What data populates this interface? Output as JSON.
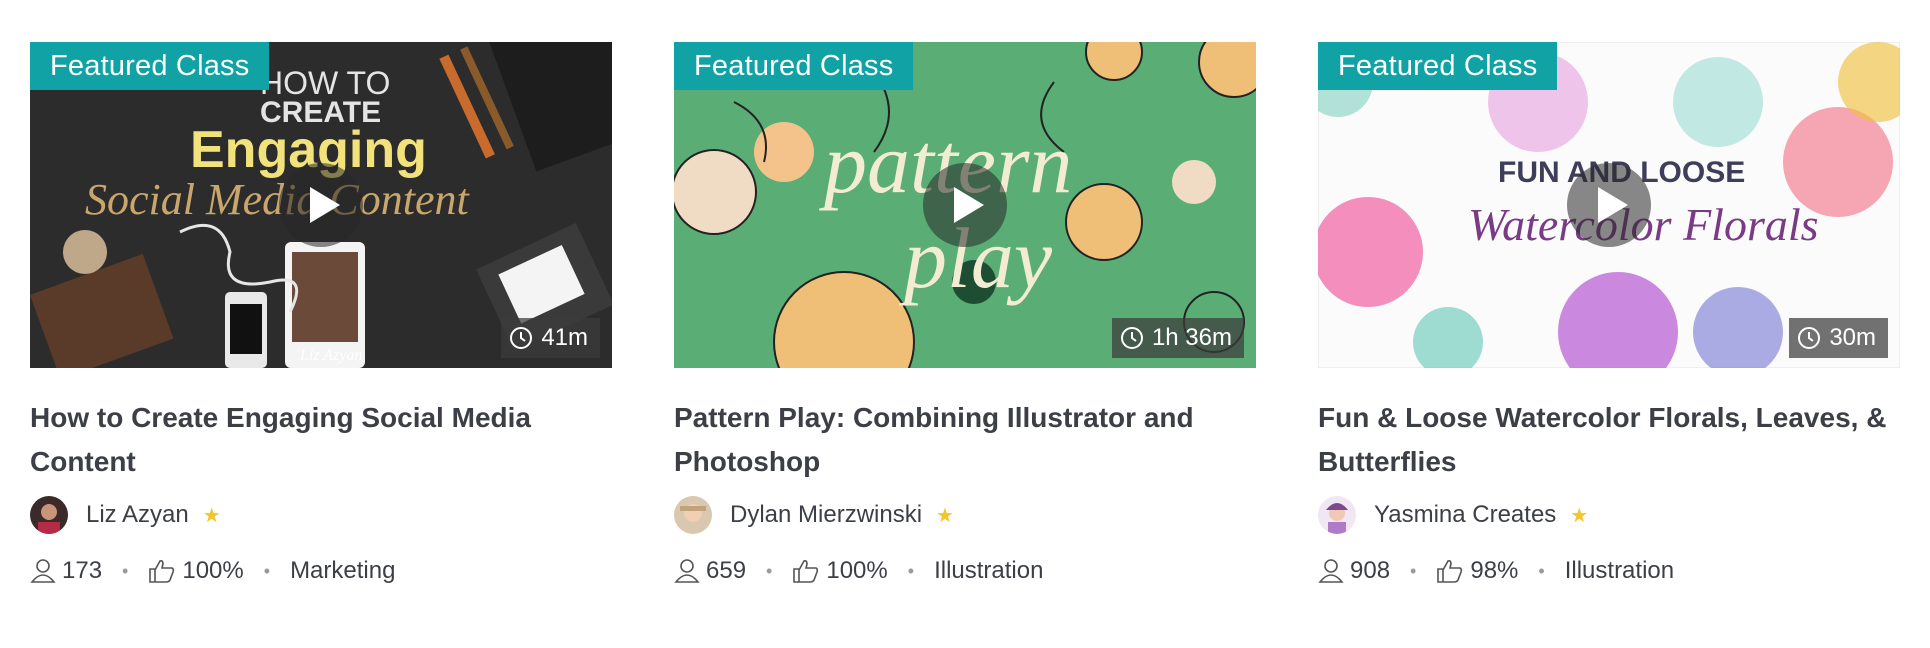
{
  "cards": [
    {
      "badge": "Featured Class",
      "duration": "41m",
      "title_line1": "How to Create Engaging Social Media",
      "title_line2": "Content",
      "teacher": "Liz Azyan",
      "students": "173",
      "rating": "100%",
      "category": "Marketing",
      "art_text": {
        "line1": "HOW TO",
        "line2": "CREATE",
        "line3": "Engaging",
        "line4": "Social Media Content",
        "caption": "Liz Azyan"
      }
    },
    {
      "badge": "Featured Class",
      "duration": "1h 36m",
      "title_line1": "Pattern Play: Combining Illustrator and",
      "title_line2": "Photoshop",
      "teacher": "Dylan Mierzwinski",
      "students": "659",
      "rating": "100%",
      "category": "Illustration",
      "art_text": {
        "line1": "pattern",
        "line2": "play"
      }
    },
    {
      "badge": "Featured Class",
      "duration": "30m",
      "title_line1": "Fun & Loose Watercolor Florals, Leaves, &",
      "title_line2": "Butterflies",
      "teacher": "Yasmina Creates",
      "students": "908",
      "rating": "98%",
      "category": "Illustration",
      "art_text": {
        "line1": "FUN AND LOOSE",
        "line2": "Watercolor Florals"
      }
    }
  ],
  "icons": {
    "play": "play-icon",
    "clock": "clock-icon",
    "star": "star-icon",
    "students": "user-icon",
    "rating": "thumbs-up-icon"
  },
  "colors": {
    "badge": "#11a2a6",
    "star": "#f4c42a",
    "card2_bg": "#5aae75"
  }
}
